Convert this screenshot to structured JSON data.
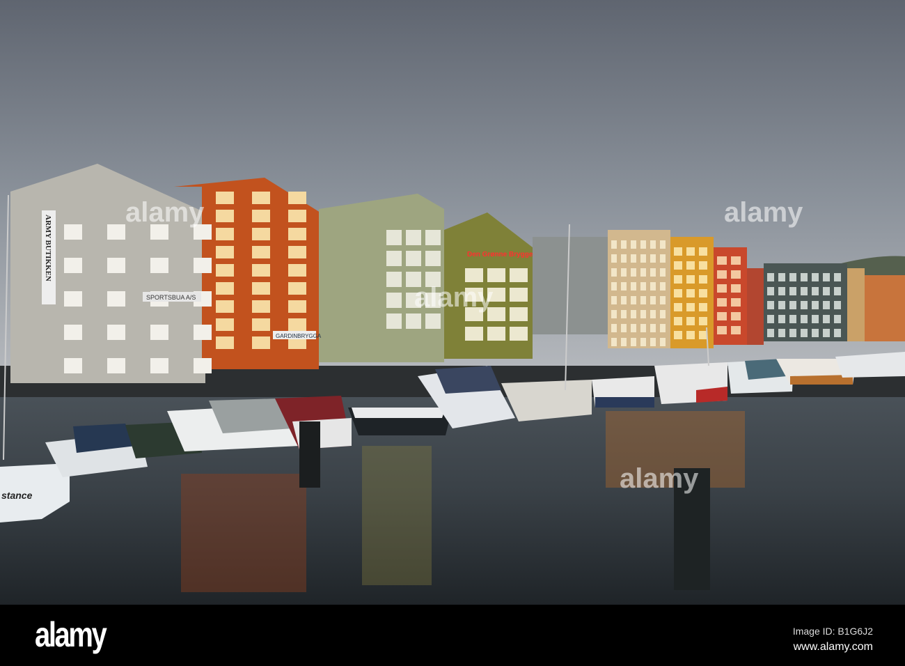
{
  "photo": {
    "signs": {
      "army_butikken": "ARMY BUTIKKEN",
      "sportsbua": "SPORTSBUA A/S",
      "gardinbrygga": "GARDINBRYGGA",
      "den_gronne_brygge": "Den Grønne Brygge",
      "boat_name": "stance"
    },
    "colors": {
      "sky": "#7d848f",
      "water": "#2f3438",
      "grey_building": "#b8b6ae",
      "orange_building": "#c2521e",
      "green_building": "#9ea580",
      "olive_building": "#7f8138",
      "yellow_building": "#d99a2a",
      "red_building": "#c9482c"
    },
    "watermark": "alamy"
  },
  "footer": {
    "logo": "alamy",
    "image_id": "Image ID: B1G6J2",
    "url": "www.alamy.com"
  }
}
